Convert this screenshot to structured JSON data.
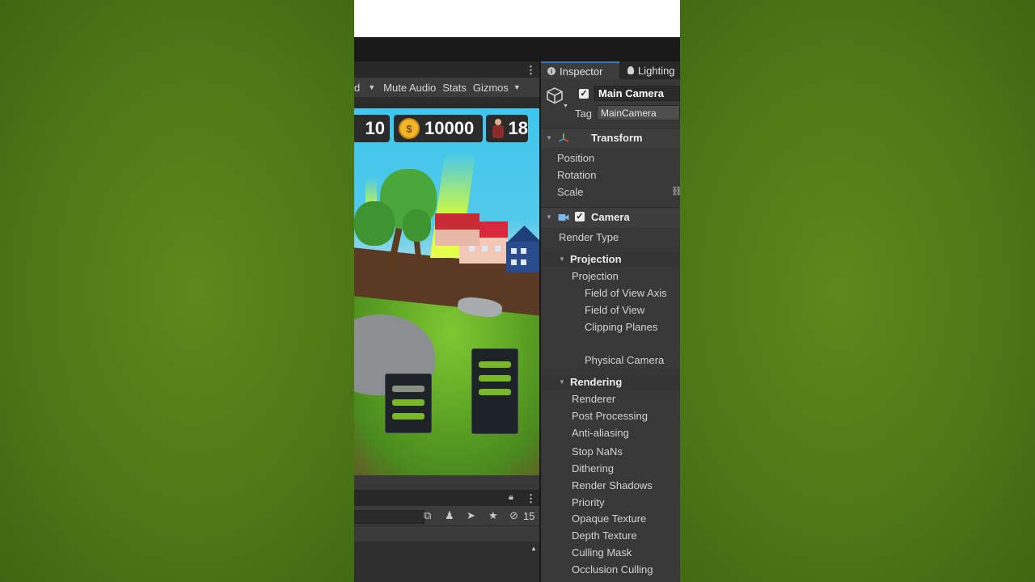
{
  "game_toolbar": {
    "partial_label": "d",
    "mute_audio": "Mute Audio",
    "stats": "Stats",
    "gizmos": "Gizmos"
  },
  "hud": {
    "level_value": "10",
    "coins_value": "10000",
    "coin_symbol": "$",
    "workers_value": "18"
  },
  "bottom_panel": {
    "hidden_count": "15"
  },
  "inspector": {
    "tabs": [
      {
        "label": "Inspector",
        "icon": "info-icon"
      },
      {
        "label": "Lighting",
        "icon": "bulb-icon"
      }
    ],
    "object_name": "Main Camera",
    "object_active": true,
    "tag_label": "Tag",
    "tag_value": "MainCamera",
    "transform": {
      "title": "Transform",
      "props": [
        "Position",
        "Rotation",
        "Scale"
      ]
    },
    "camera": {
      "title": "Camera",
      "render_type": "Render Type",
      "projection_header": "Projection",
      "projection_props": [
        "Projection",
        "Field of View Axis",
        "Field of View",
        "Clipping Planes",
        "Physical Camera"
      ],
      "rendering_header": "Rendering",
      "rendering_props": [
        "Renderer",
        "Post Processing",
        "Anti-aliasing",
        "Stop NaNs",
        "Dithering",
        "Render Shadows",
        "Priority",
        "Opaque Texture",
        "Depth Texture",
        "Culling Mask",
        "Occlusion Culling"
      ]
    }
  },
  "colors": {
    "editor_bg": "#383838",
    "panel_dark": "#282828",
    "accent_blue": "#3a79bb",
    "bg_green": "#4f7a17"
  }
}
